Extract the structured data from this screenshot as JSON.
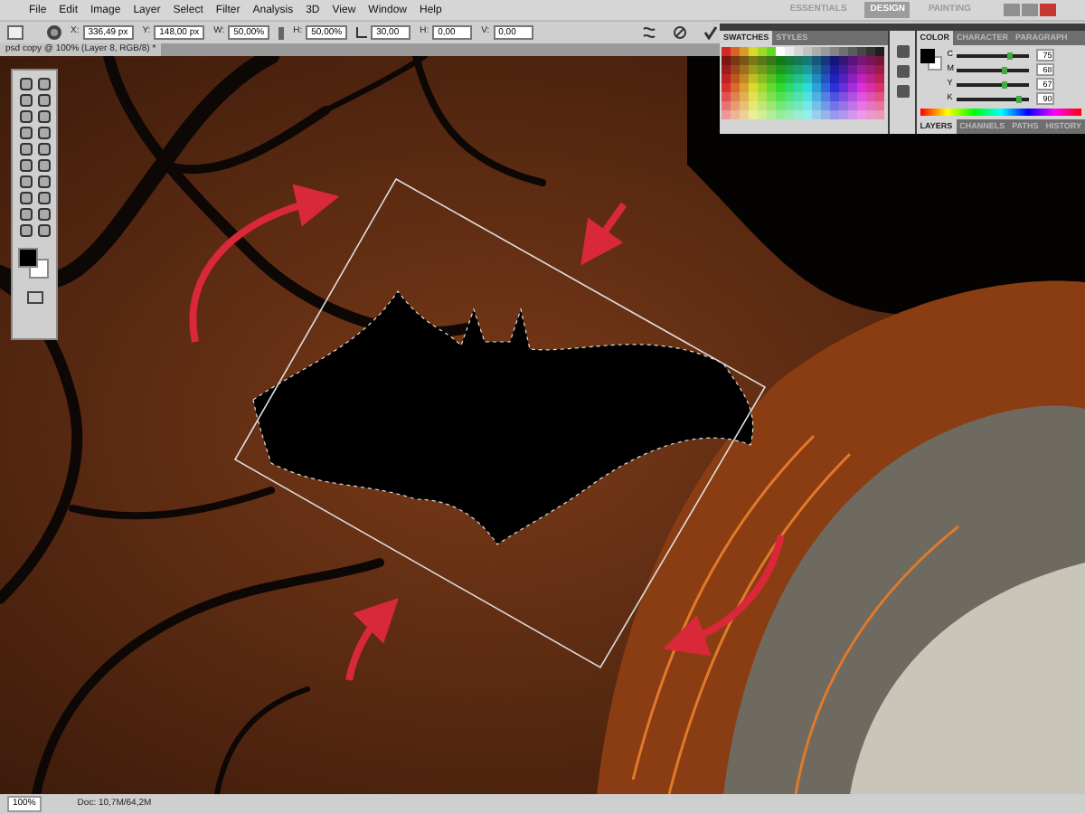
{
  "menu": [
    "File",
    "Edit",
    "Image",
    "Layer",
    "Select",
    "Filter",
    "Analysis",
    "3D",
    "View",
    "Window",
    "Help"
  ],
  "workspaces": [
    {
      "label": "ESSENTIALS",
      "selected": false
    },
    {
      "label": "DESIGN",
      "selected": true
    },
    {
      "label": "PAINTING",
      "selected": false
    }
  ],
  "options": [
    {
      "kind": "field",
      "label": "X:",
      "value": "336,49 px"
    },
    {
      "kind": "field",
      "label": "Y:",
      "value": "148,00 px"
    },
    {
      "kind": "field",
      "label": "W:",
      "value": "50,00%"
    },
    {
      "kind": "field",
      "label": "H:",
      "value": "50,00%"
    },
    {
      "kind": "angle",
      "value": "30,00"
    },
    {
      "kind": "field",
      "label": "H:",
      "value": "0,00"
    },
    {
      "kind": "field",
      "label": "V:",
      "value": "0,00"
    }
  ],
  "document_tab": "psd copy @ 100% (Layer 8, RGB/8) *",
  "swatches_panel": {
    "tabs": [
      {
        "label": "SWATCHES",
        "selected": true
      },
      {
        "label": "STYLES",
        "selected": false
      }
    ]
  },
  "color_panel": {
    "tabs": [
      {
        "label": "COLOR",
        "selected": true
      },
      {
        "label": "CHARACTER",
        "selected": false
      },
      {
        "label": "PARAGRAPH",
        "selected": false
      }
    ],
    "sliders": [
      {
        "label": "C",
        "level": 0.75,
        "reading": "75"
      },
      {
        "label": "M",
        "level": 0.68,
        "reading": "68"
      },
      {
        "label": "Y",
        "level": 0.67,
        "reading": "67"
      },
      {
        "label": "K",
        "level": 0.9,
        "reading": "90"
      }
    ]
  },
  "layers_panel": {
    "tabs": [
      {
        "label": "LAYERS",
        "selected": true
      },
      {
        "label": "CHANNELS",
        "selected": false
      },
      {
        "label": "PATHS",
        "selected": false
      },
      {
        "label": "HISTORY",
        "selected": false
      }
    ]
  },
  "status_bar": {
    "zoom": "100%",
    "document": "Doc: 10,7M/64,2M"
  }
}
